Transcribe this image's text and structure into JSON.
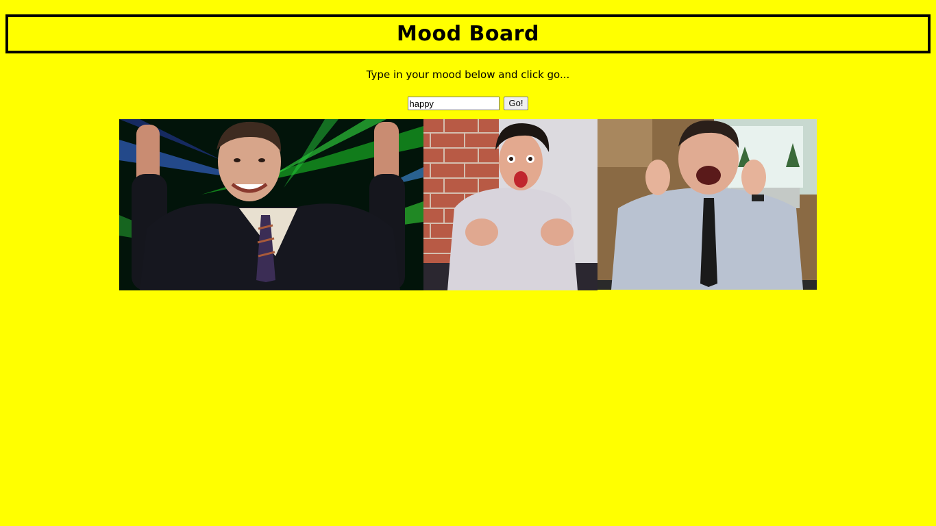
{
  "header": {
    "title": "Mood Board"
  },
  "instructions": "Type in your mood below and click go...",
  "search": {
    "value": "happy",
    "button_label": "Go!"
  },
  "gifs": [
    {
      "name": "gif-dancing-man-lasers"
    },
    {
      "name": "gif-excited-man-brick-wall"
    },
    {
      "name": "gif-cheering-man-office"
    }
  ],
  "colors": {
    "background": "#ffff00",
    "border": "#000000"
  }
}
